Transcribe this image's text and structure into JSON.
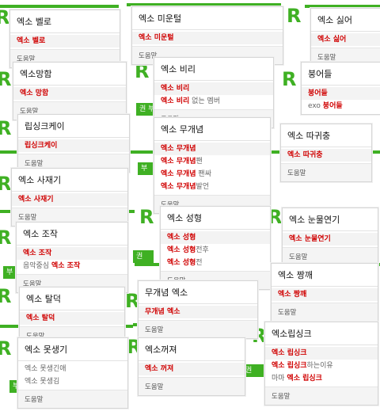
{
  "logo_letter": "R",
  "help_label": "도움말",
  "accent_color": "#3fb023",
  "highlight_color": "#d00000",
  "strip_texts": {
    "a": "권 부",
    "b": "부",
    "c": "부",
    "d": "권",
    "e": "부"
  },
  "cards": {
    "c1": {
      "title": "엑소 벨로",
      "rows": [
        {
          "hl": "엑소 벨로",
          "rest": ""
        }
      ]
    },
    "c2": {
      "title": "엑소 미운털",
      "rows": [
        {
          "hl": "엑소 미운털",
          "rest": ""
        }
      ]
    },
    "c3": {
      "title": "엑소 싫어",
      "rows": [
        {
          "hl": "엑소 싫어",
          "rest": ""
        }
      ]
    },
    "c4": {
      "title": "엑소망함",
      "rows": [
        {
          "hl": "엑소 망함",
          "rest": ""
        }
      ]
    },
    "c5": {
      "title": "엑소 비리",
      "rows": [
        {
          "hl": "엑소 비리",
          "rest": ""
        },
        {
          "hl": "엑소 비리",
          "rest": " 없는 멤버"
        }
      ]
    },
    "c6": {
      "title": "붕어들",
      "rows": [
        {
          "pre": "",
          "hl": "붕어들",
          "rest": ""
        },
        {
          "pre": "exo ",
          "hl": "붕어들",
          "rest": ""
        }
      ]
    },
    "c7": {
      "title": "립싱크케이",
      "rows": [
        {
          "hl": "립싱크케이",
          "rest": ""
        }
      ]
    },
    "c8": {
      "title": "엑소 무개념",
      "rows": [
        {
          "hl": "엑소 무개념",
          "rest": ""
        },
        {
          "hl": "엑소 무개념",
          "rest": "팬"
        },
        {
          "hl": "엑소 무개념",
          "rest": " 팬싸"
        },
        {
          "hl": "엑소 무개념",
          "rest": "발언"
        }
      ]
    },
    "c9": {
      "title": "엑소 따귀충",
      "rows": [
        {
          "hl": "엑소 따귀충",
          "rest": ""
        }
      ]
    },
    "c10": {
      "title": "엑소 사재기",
      "rows": [
        {
          "hl": "엑소 사재기",
          "rest": ""
        }
      ]
    },
    "c11": {
      "title": "엑소 성형",
      "rows": [
        {
          "hl": "엑소 성형",
          "rest": ""
        },
        {
          "hl": "엑소 성형",
          "rest": "전후"
        },
        {
          "hl": "엑소 성형",
          "rest": "전"
        }
      ]
    },
    "c12": {
      "title": "엑소 눈물연기",
      "rows": [
        {
          "hl": "엑소 눈물연기",
          "rest": ""
        }
      ]
    },
    "c13": {
      "title": "엑소 조작",
      "rows": [
        {
          "pre": "",
          "hl": "엑소 조작",
          "rest": ""
        },
        {
          "pre": "음악중심 ",
          "hl": "엑소 조작",
          "rest": ""
        }
      ]
    },
    "c14": {
      "title": "엑소 짱깨",
      "rows": [
        {
          "hl": "엑소 짱깨",
          "rest": ""
        }
      ]
    },
    "c15": {
      "title": "무개념 엑소",
      "rows": [
        {
          "hl": "무개념 엑소",
          "rest": ""
        }
      ]
    },
    "c16": {
      "title": "엑소 탈덕",
      "rows": [
        {
          "hl": "엑소 탈덕",
          "rest": ""
        }
      ]
    },
    "c17": {
      "title": "엑소 못생기",
      "rows": [
        {
          "pre": "엑소 못생긴애",
          "hl": "",
          "rest": ""
        },
        {
          "pre": "엑소 못생김",
          "hl": "",
          "rest": ""
        }
      ]
    },
    "c18": {
      "title": "엑소꺼져",
      "rows": [
        {
          "hl": "엑소 꺼져",
          "rest": ""
        }
      ]
    },
    "c19": {
      "title": "엑소립싱크",
      "rows": [
        {
          "pre": "",
          "hl": "엑소 립싱크",
          "rest": ""
        },
        {
          "pre": "",
          "hl": "엑소 립싱크",
          "rest": "하는이유"
        },
        {
          "pre": "마마 ",
          "hl": "엑소 립싱크",
          "rest": ""
        }
      ]
    }
  }
}
